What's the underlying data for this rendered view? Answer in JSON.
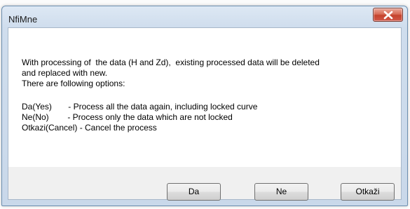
{
  "window": {
    "title": "NfiMne",
    "close_icon": "close-x-icon",
    "close_color": "#c4432c"
  },
  "message": {
    "line1": "With processing of  the data (H and Zd),  existing processed data will be deleted",
    "line2": "and replaced with new.",
    "line3": "There are following options:",
    "option_yes": "Da(Yes)       - Process all the data again, including locked curve",
    "option_no": "Ne(No)        - Process only the data which are not locked",
    "option_cancel": "Otkazi(Cancel) - Cancel the process"
  },
  "buttons": {
    "yes": "Da",
    "no": "Ne",
    "cancel": "Otkaži"
  }
}
